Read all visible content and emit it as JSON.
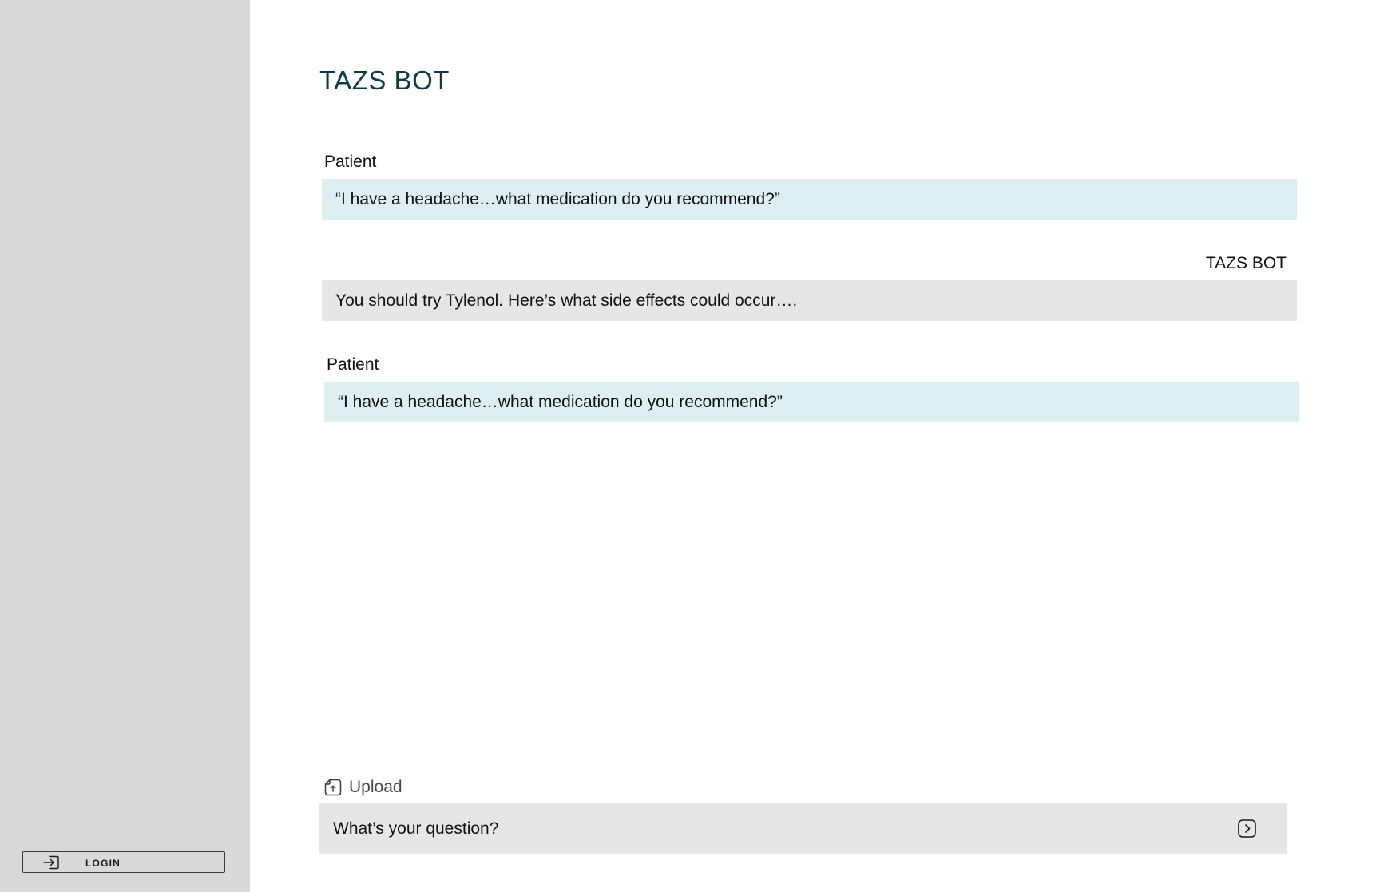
{
  "sidebar": {
    "login_label": "LOGIN",
    "login_icon": "login-arrow-icon"
  },
  "header": {
    "title": "TAZS BOT"
  },
  "conversation": [
    {
      "speaker": "Patient",
      "role": "patient",
      "message": "“I have a headache…what medication do you recommend?”"
    },
    {
      "speaker": "TAZS BOT",
      "role": "bot",
      "message": "You should try Tylenol. Here’s what side effects could occur…."
    },
    {
      "speaker": "Patient",
      "role": "patient",
      "message": "“I have a headache…what medication do you recommend?”"
    }
  ],
  "composer": {
    "upload_label": "Upload",
    "upload_icon": "file-upload-icon",
    "placeholder": "What’s your question?",
    "send_icon": "chevron-right-square-icon"
  },
  "colors": {
    "sidebar_bg": "#d9d9d9",
    "title": "#0d3b44",
    "patient_bubble": "#deeff2",
    "bot_bubble": "#e6e6e6"
  }
}
